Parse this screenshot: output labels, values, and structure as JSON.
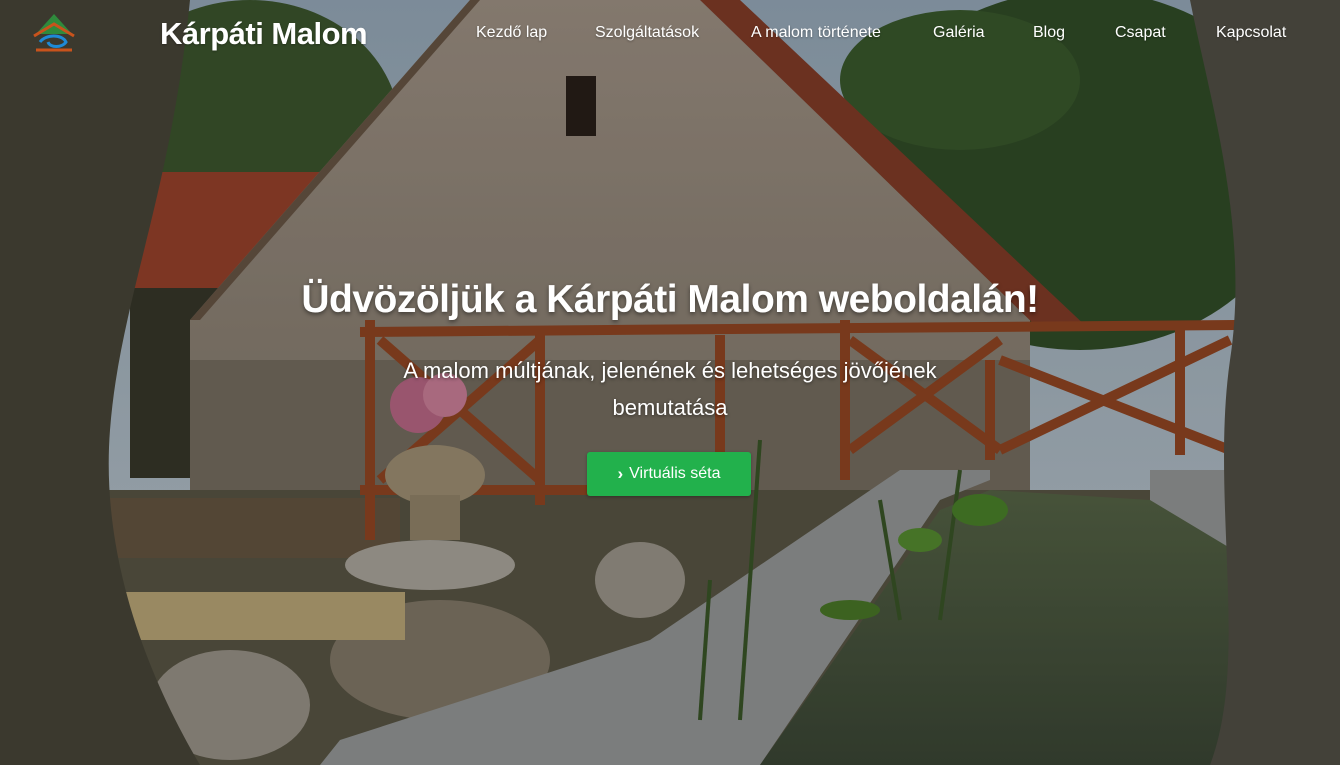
{
  "brand": {
    "name": "Kárpáti Malom",
    "logo_icon": "mill-logo-icon"
  },
  "nav": {
    "items": [
      {
        "label": "Kezdő lap"
      },
      {
        "label": "Szolgáltatások"
      },
      {
        "label": "A malom története"
      },
      {
        "label": "Galéria"
      },
      {
        "label": "Blog"
      },
      {
        "label": "Csapat"
      },
      {
        "label": "Kapcsolat"
      }
    ]
  },
  "hero": {
    "title": "Üdvözöljük a Kárpáti Malom weboldalán!",
    "subtitle": "A malom múltjának, jelenének és lehetséges jövőjének bemutatása",
    "cta": {
      "label": "Virtuális séta",
      "icon": "chevron-right-icon",
      "color": "#22b14c"
    }
  }
}
